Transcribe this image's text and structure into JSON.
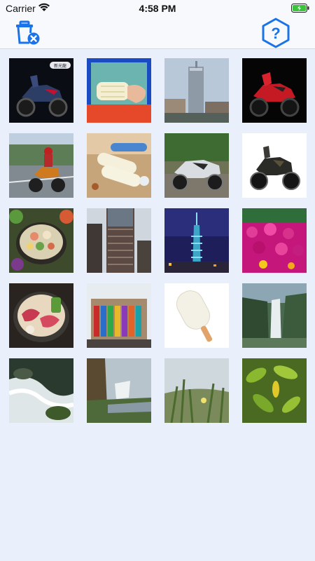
{
  "status": {
    "carrier": "Carrier",
    "time": "4:58 PM"
  },
  "nav": {
    "left_icon": "delete-trash-icon",
    "right_icon": "help-question-icon",
    "help_glyph": "?",
    "accent_color": "#1a73e8"
  },
  "photos": [
    {
      "subject": "motorcycle-blue-scooter",
      "badge": "新光龍"
    },
    {
      "subject": "popsicle-hand"
    },
    {
      "subject": "city-skyscraper"
    },
    {
      "subject": "motorcycle-red-scooter"
    },
    {
      "subject": "rider-on-motorcycle"
    },
    {
      "subject": "popsicles-bottle"
    },
    {
      "subject": "motorcycle-silver-sport"
    },
    {
      "subject": "motorcycle-black-naked"
    },
    {
      "subject": "hotpot-dish"
    },
    {
      "subject": "glass-office-tower"
    },
    {
      "subject": "taipei-101-night"
    },
    {
      "subject": "pink-flowers"
    },
    {
      "subject": "hotpot-meat"
    },
    {
      "subject": "colorful-building"
    },
    {
      "subject": "white-popsicle"
    },
    {
      "subject": "waterfall-cliff"
    },
    {
      "subject": "river-stream-rocks"
    },
    {
      "subject": "waterfall-canyon"
    },
    {
      "subject": "grass-closeup"
    },
    {
      "subject": "green-leaves-plant"
    }
  ]
}
